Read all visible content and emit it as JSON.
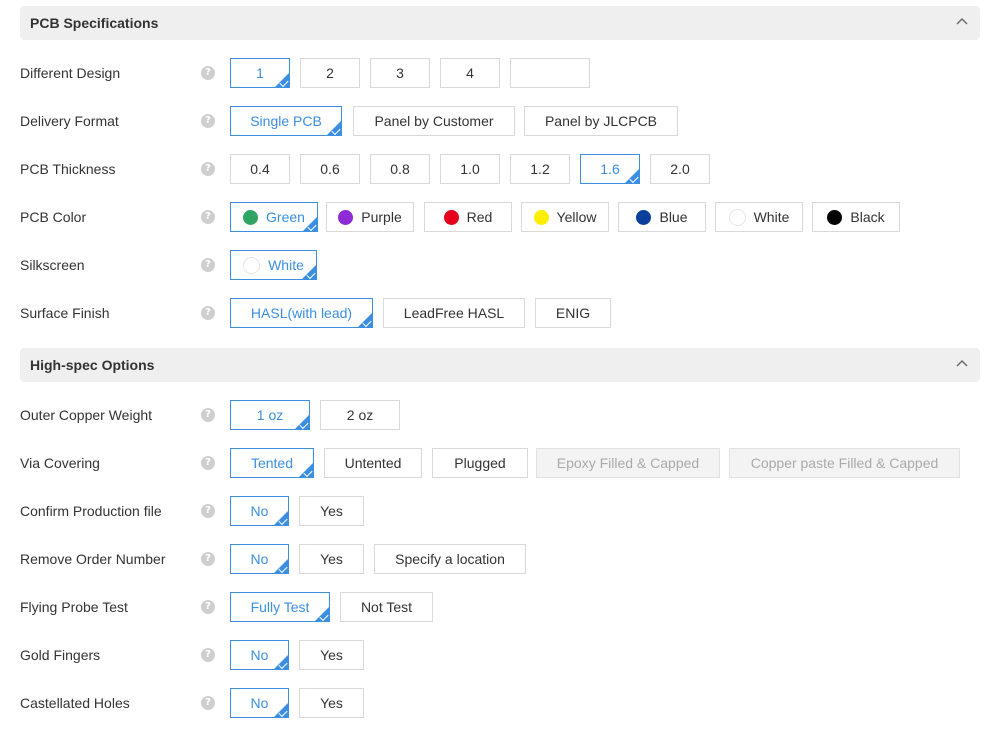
{
  "sections": {
    "pcb_specs": {
      "title": "PCB Specifications"
    },
    "high_spec": {
      "title": "High-spec Options"
    }
  },
  "rows": {
    "different_design": {
      "label": "Different Design",
      "options": [
        "1",
        "2",
        "3",
        "4",
        ""
      ],
      "selected": "1"
    },
    "delivery_format": {
      "label": "Delivery Format",
      "options": [
        "Single PCB",
        "Panel by Customer",
        "Panel by JLCPCB"
      ],
      "selected": "Single PCB"
    },
    "pcb_thickness": {
      "label": "PCB Thickness",
      "options": [
        "0.4",
        "0.6",
        "0.8",
        "1.0",
        "1.2",
        "1.6",
        "2.0"
      ],
      "selected": "1.6"
    },
    "pcb_color": {
      "label": "PCB Color",
      "options": [
        "Green",
        "Purple",
        "Red",
        "Yellow",
        "Blue",
        "White",
        "Black"
      ],
      "colors": [
        "#2fa463",
        "#8e2bd6",
        "#e5001b",
        "#ffee00",
        "#0b3f9c",
        "#ffffff",
        "#000000"
      ],
      "selected": "Green"
    },
    "silkscreen": {
      "label": "Silkscreen",
      "options": [
        "White"
      ],
      "colors": [
        "#ffffff"
      ],
      "selected": "White"
    },
    "surface_finish": {
      "label": "Surface Finish",
      "options": [
        "HASL(with lead)",
        "LeadFree HASL",
        "ENIG"
      ],
      "selected": "HASL(with lead)"
    },
    "outer_copper_weight": {
      "label": "Outer Copper Weight",
      "options": [
        "1 oz",
        "2 oz"
      ],
      "selected": "1 oz"
    },
    "via_covering": {
      "label": "Via Covering",
      "options": [
        "Tented",
        "Untented",
        "Plugged",
        "Epoxy Filled & Capped",
        "Copper paste Filled & Capped"
      ],
      "selected": "Tented",
      "disabled": [
        "Epoxy Filled & Capped",
        "Copper paste Filled & Capped"
      ]
    },
    "confirm_production_file": {
      "label": "Confirm Production file",
      "options": [
        "No",
        "Yes"
      ],
      "selected": "No"
    },
    "remove_order_number": {
      "label": "Remove Order Number",
      "options": [
        "No",
        "Yes",
        "Specify a location"
      ],
      "selected": "No"
    },
    "flying_probe_test": {
      "label": "Flying Probe Test",
      "options": [
        "Fully Test",
        "Not Test"
      ],
      "selected": "Fully Test"
    },
    "gold_fingers": {
      "label": "Gold Fingers",
      "options": [
        "No",
        "Yes"
      ],
      "selected": "No"
    },
    "castellated_holes": {
      "label": "Castellated Holes",
      "options": [
        "No",
        "Yes"
      ],
      "selected": "No"
    }
  },
  "help_glyph": "?",
  "theme": {
    "accent": "#3b8ee0",
    "header_bg": "#efefef",
    "border": "#d9d9d9"
  }
}
